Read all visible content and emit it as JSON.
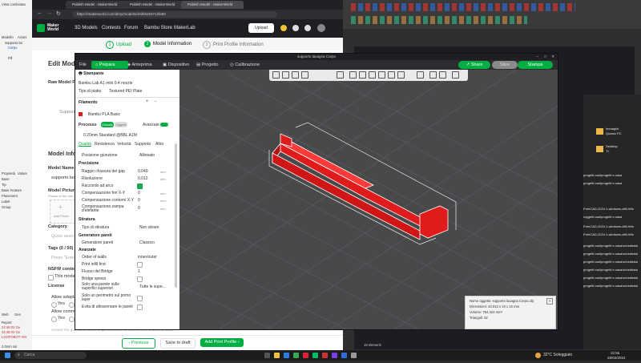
{
  "taskbar": {
    "search_placeholder": "Cerca",
    "weather": "32°C Soleggiato",
    "time": "22:56",
    "date": "28/02/2024"
  },
  "background_cad": {
    "left_panel_items": [
      "Vista combinata",
      "Modello",
      "Azioni",
      "supporto bo",
      "Corpo",
      "Fill",
      "Proprietà",
      "Valore",
      "Base",
      "Tip",
      "Base Feature",
      "Placement",
      "Label",
      "Group"
    ],
    "report_lines": [
      "Report",
      "22:46:02 Ge",
      "22:46:02 Ge",
      "LOOFOBOT: MV",
      "Web",
      "Gen"
    ],
    "status": "2.0mm sul",
    "right_list": [
      "Immagini",
      "Questo PC",
      "Desktop",
      "TL",
      "progetti cad/progetti e.casa",
      "progetti cad/progetti e.casa",
      "FreeCAD-2024.1-windows-x86-Win",
      "roggetti cad/progetti e.casa",
      "FreeCAD-2024.1-windows-x86-Win",
      "FreeCAD-2024.1-windows-x86-Win",
      "progetti cad/progetti e.casa/scheddata",
      "progetti cad/progetti e.casa/scheddata",
      "progetti cad/progetti e.casa/scheddata",
      "progetti cad/progetti e.casa/scheddata",
      "progetti cad/progetti e.casa/scheddata",
      "progetti cad/progetti e.casa/scheddata"
    ],
    "bottom_text": "19 elementi"
  },
  "browser": {
    "tabs": [
      "Publish Model - MakerWorld",
      "Publish Model - MakerWorld",
      "Publish Model - MakerWorld"
    ],
    "url": "https://makerworld.com/it/my/models/draft/6283712fa60",
    "nav": {
      "logo": "Maker World",
      "links": [
        "3D Models",
        "Contests",
        "Forum",
        "Bambu Store",
        "MakerLab"
      ],
      "upload_label": "Upload"
    },
    "steps": [
      {
        "num": "1",
        "label": "Upload"
      },
      {
        "num": "2",
        "label": "Model Information"
      },
      {
        "num": "3",
        "label": "Print Profile Information"
      }
    ],
    "content": {
      "edit_title": "Edit Model",
      "raw_files_label": "Raw Model Files",
      "supported_label": "Supporte",
      "model_info_title": "Model Infor",
      "model_name_label": "Model Name",
      "model_name_value": "supporto las",
      "model_pictures_label": "Model Pictures",
      "model_pictures_hint": "Please at the artic",
      "add_photo": "Add Photo",
      "category_label": "Category",
      "quick_search": "Quick search",
      "tags_label": "Tags (0 / 50)",
      "tags_placeholder": "Press \"Enter",
      "nsfw_label": "NSFW content f",
      "nsfw_check": "This model c",
      "license_label": "License",
      "allow_adapt": "Allow adaptat",
      "yes1": "Yes",
      "no1": "No",
      "allow_comm": "Allow comme",
      "yes2": "Yes",
      "no2": "No",
      "bottom_hint": "Answer the questions above to get a license, or click here to select manually."
    },
    "bottom_buttons": {
      "previous": "Previous",
      "save_draft": "Save to draft",
      "add_profile": "Add Print Profile"
    }
  },
  "bambu": {
    "title": "supporto lavagna Corpo",
    "file_menu": "File",
    "tabs": [
      "Prepara",
      "Anteprima",
      "Dispositivo",
      "Progetto",
      "Calibrazione"
    ],
    "share": "Share",
    "slice": "Slice",
    "print": "Stampa",
    "printer_section": "Stampante",
    "printer_name": "Bambu Lab A1 mini 0.4 nozzle",
    "plate_label": "Tipo di piatto",
    "plate_value": "Textured PEI Plate",
    "filament_section": "Filamento",
    "filament_name": "Bambu PLA Basic",
    "process_label": "Processo",
    "process_badge_global": "Globale",
    "process_badge_object": "Oggetti",
    "advanced_label": "Avanzate",
    "profile_name": "0.20mm Standard @BBL A1M",
    "quality_tabs": [
      "Qualità",
      "Resistenza",
      "Velocità",
      "Supporto",
      "Altro"
    ],
    "params": {
      "seam_label": "Posizione giunzione",
      "seam_value": "Allineato",
      "precision_section": "Precisione",
      "gap_label": "Raggio chiusura del gap",
      "gap_value": "0.049",
      "resolution_label": "Risoluzione",
      "resolution_value": "0.012",
      "arc_label": "Raccordo ad arco",
      "hole_comp_label": "Compensazione fori X-Y",
      "hole_comp_value": "0",
      "contour_comp_label": "Compensazione contorni X-Y",
      "contour_comp_value": "0",
      "elephant_label": "Compensazione zampa d'elefante",
      "elephant_value": "0",
      "unit_mm": "mm",
      "ironing_section": "Stiratura",
      "ironing_type_label": "Tipo di stiratura",
      "ironing_type_value": "Non stirare",
      "wall_gen_section": "Generatore pareti",
      "wall_gen_label": "Generatore pareti",
      "wall_gen_value": "Classico",
      "advanced_section": "Avanzate",
      "wall_order_label": "Order of walls",
      "wall_order_value": "inner/outer",
      "infill_first_label": "Print infill first",
      "bridge_flow_label": "Flusso del Bridge",
      "bridge_flow_value": "1",
      "bridge_spessi_label": "Bridge spessi",
      "single_wall_label": "Solo una parete sulle superfici superiori",
      "single_wall_value": "Tutte le supe...",
      "single_perimeter_label": "Solo un perimetro sul primo layer",
      "avoid_label": "Evita di attraversare le pareti"
    },
    "info_panel": {
      "line1": "Nome oggetto: supporto lavagna Corpo.obj",
      "line2": "Dimensioni: 43.013 x 10 x 10 mm",
      "line3": "Volume: 794.324 mm³",
      "line4": "Triangoli: 52"
    }
  },
  "colors": {
    "accent": "#00ae42",
    "model": "#e01b1b",
    "dark_bg": "#202124"
  }
}
